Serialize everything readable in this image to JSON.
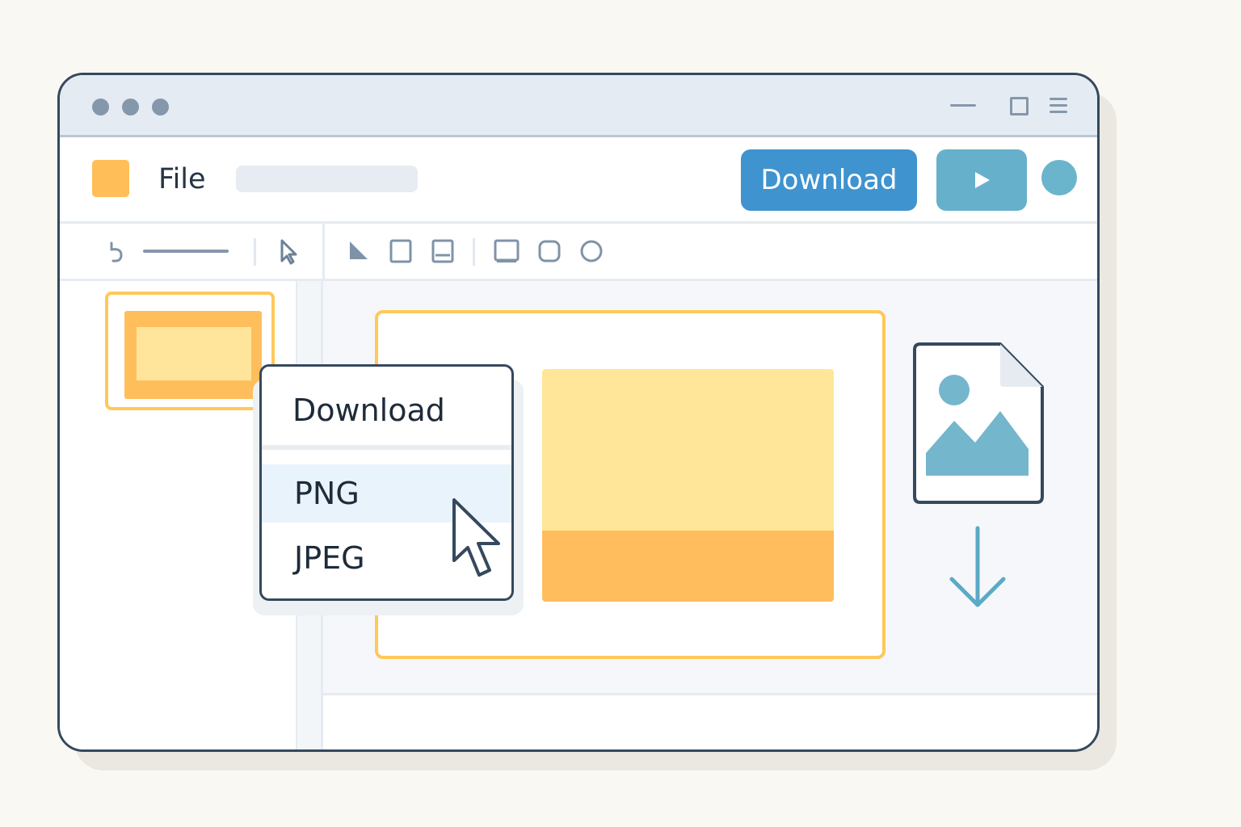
{
  "app": {
    "menu": {
      "file_label": "File"
    },
    "actions": {
      "download_label": "Download"
    }
  },
  "download_menu": {
    "header": "Download",
    "options": [
      {
        "label": "PNG",
        "highlighted": true
      },
      {
        "label": "JPEG",
        "highlighted": false
      }
    ]
  },
  "icons": {
    "titlebar": [
      "traffic-light-dot",
      "minimize-icon",
      "maximize-icon",
      "hamburger-menu-icon"
    ],
    "toolbar": [
      "undo-icon",
      "pointer-tool-icon",
      "triangle-tool-icon",
      "square-tool-icon",
      "panel-tool-icon",
      "rectangle-tool-icon",
      "rounded-rect-tool-icon",
      "circle-tool-icon"
    ],
    "canvas": [
      "image-file-icon",
      "download-arrow-icon",
      "mouse-cursor-icon"
    ]
  },
  "colors": {
    "accent_blue": "#3f93cf",
    "teal": "#67b0cb",
    "orange": "#ffbe58",
    "yellow": "#ffe699",
    "frame_border": "#34495e"
  }
}
